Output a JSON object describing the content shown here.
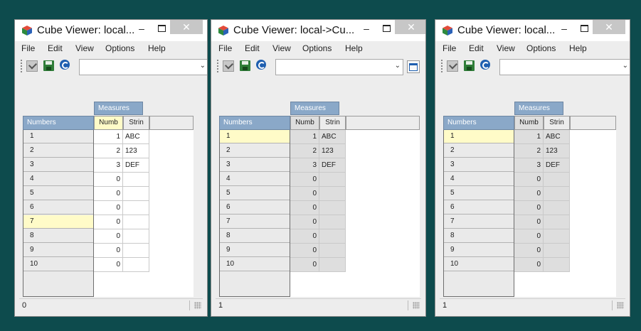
{
  "windows": [
    {
      "title": "Cube Viewer: local...",
      "menu": [
        "File",
        "Edit",
        "View",
        "Options",
        "Help"
      ],
      "measures_header": "Measures",
      "numbers_header": "Numbers",
      "columns": [
        "Numb",
        "Strin"
      ],
      "rows": [
        {
          "label": "1",
          "num": "1",
          "str": "ABC"
        },
        {
          "label": "2",
          "num": "2",
          "str": "123"
        },
        {
          "label": "3",
          "num": "3",
          "str": "DEF"
        },
        {
          "label": "4",
          "num": "0",
          "str": ""
        },
        {
          "label": "5",
          "num": "0",
          "str": ""
        },
        {
          "label": "6",
          "num": "0",
          "str": ""
        },
        {
          "label": "7",
          "num": "0",
          "str": ""
        },
        {
          "label": "8",
          "num": "0",
          "str": ""
        },
        {
          "label": "9",
          "num": "0",
          "str": ""
        },
        {
          "label": "10",
          "num": "0",
          "str": ""
        }
      ],
      "status": "0"
    },
    {
      "title": "Cube Viewer: local->Cu...",
      "menu": [
        "File",
        "Edit",
        "View",
        "Options",
        "Help"
      ],
      "measures_header": "Measures",
      "numbers_header": "Numbers",
      "columns": [
        "Numb",
        "Strin"
      ],
      "rows": [
        {
          "label": "1",
          "num": "1",
          "str": "ABC"
        },
        {
          "label": "2",
          "num": "2",
          "str": "123"
        },
        {
          "label": "3",
          "num": "3",
          "str": "DEF"
        },
        {
          "label": "4",
          "num": "0",
          "str": ""
        },
        {
          "label": "5",
          "num": "0",
          "str": ""
        },
        {
          "label": "6",
          "num": "0",
          "str": ""
        },
        {
          "label": "7",
          "num": "0",
          "str": ""
        },
        {
          "label": "8",
          "num": "0",
          "str": ""
        },
        {
          "label": "9",
          "num": "0",
          "str": ""
        },
        {
          "label": "10",
          "num": "0",
          "str": ""
        }
      ],
      "status": "1"
    },
    {
      "title": "Cube Viewer: local...",
      "menu": [
        "File",
        "Edit",
        "View",
        "Options",
        "Help"
      ],
      "measures_header": "Measures",
      "numbers_header": "Numbers",
      "columns": [
        "Numb",
        "Strin"
      ],
      "rows": [
        {
          "label": "1",
          "num": "1",
          "str": "ABC"
        },
        {
          "label": "2",
          "num": "2",
          "str": "123"
        },
        {
          "label": "3",
          "num": "3",
          "str": "DEF"
        },
        {
          "label": "4",
          "num": "0",
          "str": ""
        },
        {
          "label": "5",
          "num": "0",
          "str": ""
        },
        {
          "label": "6",
          "num": "0",
          "str": ""
        },
        {
          "label": "7",
          "num": "0",
          "str": ""
        },
        {
          "label": "8",
          "num": "0",
          "str": ""
        },
        {
          "label": "9",
          "num": "0",
          "str": ""
        },
        {
          "label": "10",
          "num": "0",
          "str": ""
        }
      ],
      "status": "1"
    }
  ],
  "colors": {
    "desktop": "#0d4b4d",
    "header_blue": "#8aa8c8",
    "highlight_yellow": "#fffbc8"
  },
  "icons": [
    "cube-app-icon",
    "minimize-icon",
    "maximize-icon",
    "close-icon",
    "check-icon",
    "save-icon",
    "refresh-icon",
    "dropdown-arrow-icon",
    "view-mode-icon",
    "resize-grip-icon"
  ]
}
